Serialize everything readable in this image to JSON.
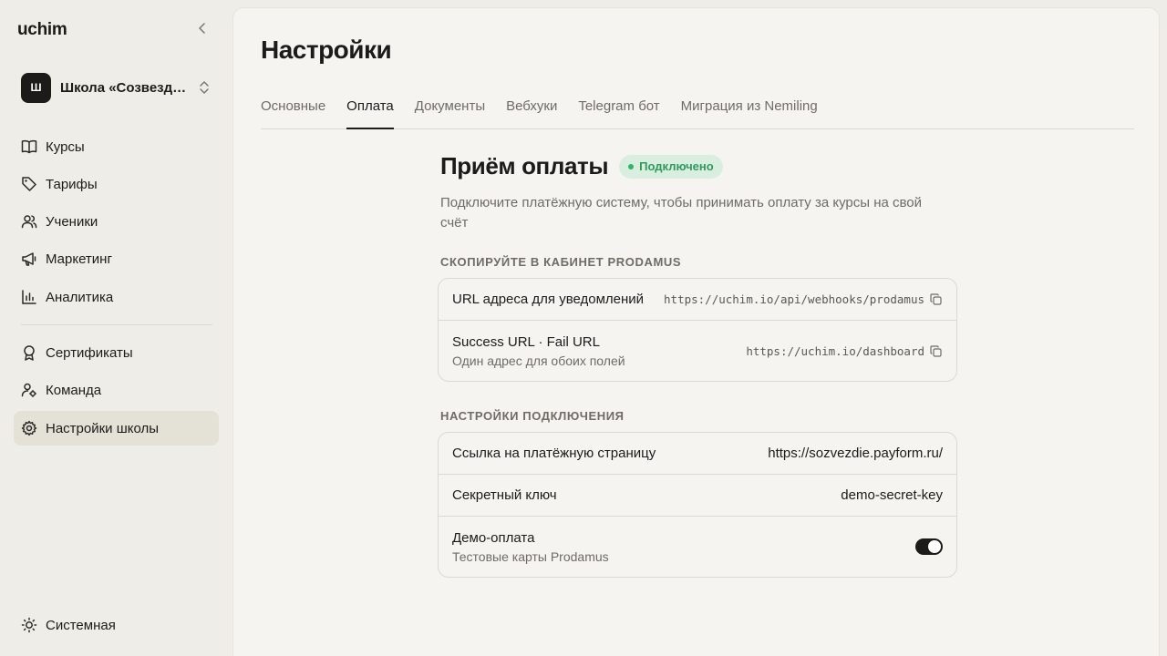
{
  "sidebar": {
    "brand": "uchim",
    "school": {
      "avatar_letter": "Ш",
      "name": "Школа «Созвездие»"
    },
    "items": [
      {
        "label": "Курсы",
        "icon": "book-icon"
      },
      {
        "label": "Тарифы",
        "icon": "tag-icon"
      },
      {
        "label": "Ученики",
        "icon": "users-icon"
      },
      {
        "label": "Маркетинг",
        "icon": "megaphone-icon"
      },
      {
        "label": "Аналитика",
        "icon": "bar-chart-icon"
      },
      {
        "label": "Сертификаты",
        "icon": "award-icon"
      },
      {
        "label": "Команда",
        "icon": "user-gear-icon"
      },
      {
        "label": "Настройки школы",
        "icon": "gear-icon"
      }
    ],
    "active_item": "Настройки школы",
    "theme_label": "Системная"
  },
  "page": {
    "title": "Настройки",
    "tabs": [
      "Основные",
      "Оплата",
      "Документы",
      "Вебхуки",
      "Telegram бот",
      "Миграция из Nemiling"
    ],
    "active_tab": "Оплата"
  },
  "payment": {
    "title": "Приём оплаты",
    "status_badge": "Подключено",
    "description": "Подключите платёжную систему, чтобы принимать оплату за курсы на свой счёт",
    "copy_group_label": "Скопируйте в кабинет Prodamus",
    "copy_rows": {
      "notify_label": "URL адреса для уведомлений",
      "notify_value": "https://uchim.io/api/webhooks/prodamus",
      "success_label": "Success URL · Fail URL",
      "success_sub": "Один адрес для обоих полей",
      "success_value": "https://uchim.io/dashboard"
    },
    "conn_group_label": "Настройки подключения",
    "conn_rows": {
      "page_link_label": "Ссылка на платёжную страницу",
      "page_link_value": "https://sozvezdie.payform.ru/",
      "secret_label": "Секретный ключ",
      "secret_value": "demo-secret-key",
      "demo_label": "Демо-оплата",
      "demo_sub": "Тестовые карты Prodamus",
      "demo_enabled": true
    }
  },
  "colors": {
    "accent_dark": "#1c1b19",
    "badge_bg": "#d9eedf",
    "badge_text": "#2f9a5a"
  }
}
